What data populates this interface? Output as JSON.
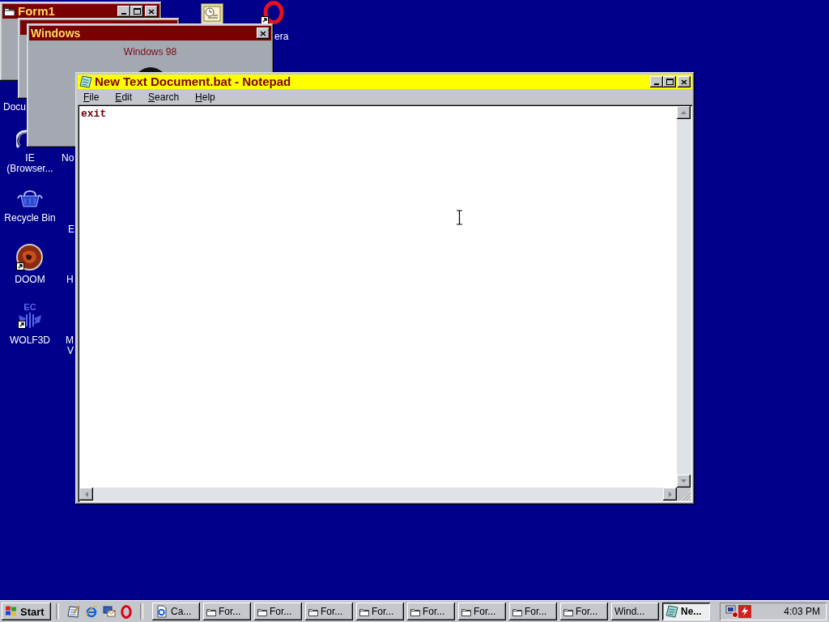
{
  "desktop_icons": [
    {
      "kind": "scheduler",
      "shortcut": false
    },
    {
      "kind": "opera",
      "label": "era",
      "shortcut": true
    },
    {
      "kind": "hidden",
      "label": "Docu"
    },
    {
      "kind": "browser",
      "label": "IE (Browser...",
      "shortcut": false
    },
    {
      "kind": "recycle",
      "label": "Recycle Bin",
      "shortcut": false
    },
    {
      "kind": "doom",
      "label": "DOOM",
      "shortcut": true
    },
    {
      "kind": "wolf",
      "label": "WOLF3D",
      "emblem_text": "EC",
      "shortcut": true
    },
    {
      "kind": "hidden",
      "label": "No"
    },
    {
      "kind": "hidden",
      "label": "E"
    },
    {
      "kind": "hidden",
      "label": "H"
    },
    {
      "kind": "hidden",
      "label": "M"
    },
    {
      "kind": "hidden",
      "label": "V"
    }
  ],
  "form1": {
    "title": "Form1",
    "active": false
  },
  "window_behind": {
    "active": false
  },
  "windows_dialog": {
    "title": "Windows",
    "active": false,
    "message": "Windows 98"
  },
  "notepad": {
    "title": "New Text Document.bat - Notepad",
    "active": true,
    "menu": [
      {
        "label": "File",
        "access_key_underlined": true
      },
      {
        "label": "Edit",
        "access_key_underlined": true
      },
      {
        "label": "Search",
        "access_key_underlined": true
      },
      {
        "label": "Help",
        "access_key_underlined": true
      }
    ],
    "text": "exit"
  },
  "taskbar": {
    "start_label": "Start",
    "quick_launch": [
      {
        "kind": "notepad"
      },
      {
        "kind": "browser"
      },
      {
        "kind": "network"
      },
      {
        "kind": "opera"
      }
    ],
    "tasks": [
      {
        "label": "Ca...",
        "kind": "browser",
        "selected": false
      },
      {
        "label": "For...",
        "kind": "folder",
        "selected": false
      },
      {
        "label": "For...",
        "kind": "folder",
        "selected": false
      },
      {
        "label": "For...",
        "kind": "folder",
        "selected": false
      },
      {
        "label": "For...",
        "kind": "folder",
        "selected": false
      },
      {
        "label": "For...",
        "kind": "folder",
        "selected": false
      },
      {
        "label": "For...",
        "kind": "folder",
        "selected": false
      },
      {
        "label": "For...",
        "kind": "folder",
        "selected": false
      },
      {
        "label": "For...",
        "kind": "folder",
        "selected": false
      },
      {
        "label": "Wind...",
        "kind": "plain",
        "selected": false
      },
      {
        "label": "Ne...",
        "kind": "notepad",
        "selected": true
      }
    ],
    "tray": [
      {
        "kind": "display"
      },
      {
        "kind": "flash"
      }
    ],
    "clock": "4:03 PM"
  }
}
